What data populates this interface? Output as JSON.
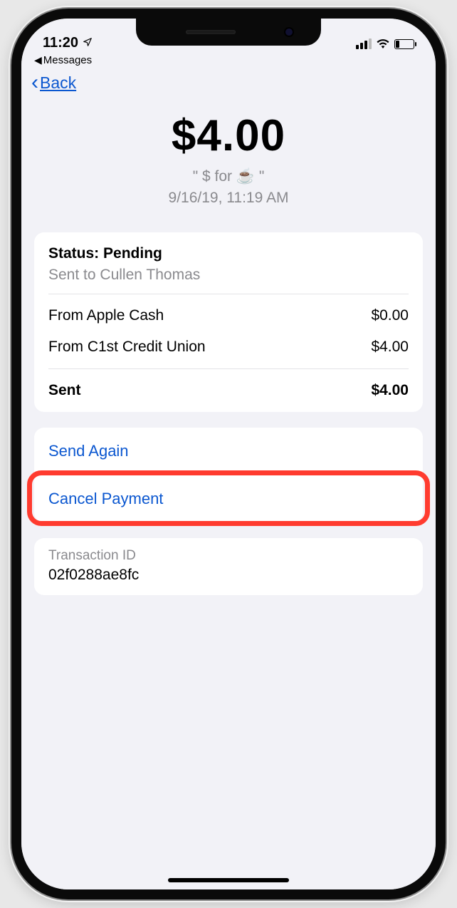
{
  "statusbar": {
    "time": "11:20",
    "breadcrumb_app": "Messages"
  },
  "nav": {
    "back_label": "Back"
  },
  "header": {
    "amount": "$4.00",
    "memo": "\" $ for ☕️ \"",
    "datetime": "9/16/19, 11:19 AM"
  },
  "details": {
    "status_label": "Status:",
    "status_value": "Pending",
    "sent_to_prefix": "Sent to",
    "sent_to_name": "Cullen Thomas",
    "sources": [
      {
        "label": "From Apple Cash",
        "amount": "$0.00"
      },
      {
        "label": "From C1st Credit Union",
        "amount": "$4.00"
      }
    ],
    "total_label": "Sent",
    "total_amount": "$4.00"
  },
  "actions": {
    "send_again": "Send Again",
    "cancel_payment": "Cancel Payment"
  },
  "transaction": {
    "label": "Transaction ID",
    "value": "02f0288ae8fc"
  }
}
